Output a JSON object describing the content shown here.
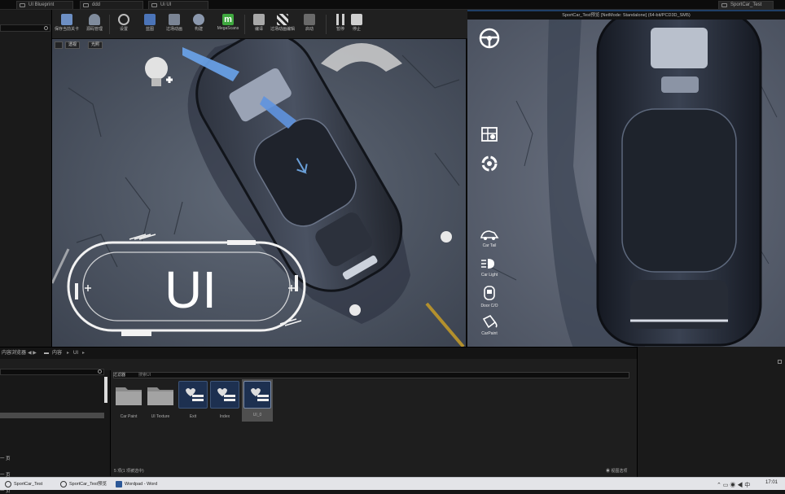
{
  "window": {
    "tabs": [
      {
        "label": "UI Blueprint"
      },
      {
        "label": "ddd"
      },
      {
        "label": "Ui UI"
      },
      {
        "label": "SportCar_Test"
      }
    ]
  },
  "toolbar": {
    "buttons": [
      {
        "label": "保存当前关卡",
        "icon": "save-icon"
      },
      {
        "label": "源码管理",
        "icon": "source-control-icon"
      },
      {
        "label": "设置",
        "icon": "settings-icon"
      },
      {
        "label": "蓝图",
        "icon": "blueprint-icon"
      },
      {
        "label": "过场动画",
        "icon": "cinematics-icon"
      },
      {
        "label": "构建",
        "icon": "build-icon"
      },
      {
        "label": "MegaScans",
        "icon": "megascans-icon"
      },
      {
        "label": "编译",
        "icon": "compile-icon"
      },
      {
        "label": "过场动画编辑",
        "icon": "clapper-icon"
      },
      {
        "label": "启动",
        "icon": "launch-icon"
      },
      {
        "label": "暂停",
        "icon": "pause-icon"
      },
      {
        "label": "停止",
        "icon": "stop-icon"
      }
    ]
  },
  "viewport": {
    "perspective_label": "透视",
    "lit_label": "光照",
    "ui_text": "UI"
  },
  "pie": {
    "title": "SportCar_Test预览 [NetMode: Standalone] (64-bit/PCD3D_SM5)",
    "side_items": [
      {
        "label": "",
        "icon": "steering-wheel-icon"
      },
      {
        "label": "",
        "icon": "map-pin-icon"
      },
      {
        "label": "",
        "icon": "swirl-icon"
      },
      {
        "label": "Car Tail",
        "icon": "car-tail-icon"
      },
      {
        "label": "Car Light",
        "icon": "car-light-icon"
      },
      {
        "label": "Door C/O",
        "icon": "door-icon"
      },
      {
        "label": "CarPaint",
        "icon": "paint-bucket-icon"
      }
    ]
  },
  "content_browser": {
    "header_label": "内容浏览器",
    "breadcrumb": [
      "内容",
      "UI"
    ],
    "filter_label": "过滤器",
    "filter_placeholder": "搜索UI",
    "tree_items": [
      "一 页",
      "一 页",
      "一 页"
    ],
    "assets": [
      {
        "name": "Car Paint",
        "type": "folder"
      },
      {
        "name": "UI Texture",
        "type": "folder"
      },
      {
        "name": "Exit",
        "type": "widget"
      },
      {
        "name": "Index",
        "type": "widget"
      },
      {
        "name": "UI_0",
        "type": "widget"
      }
    ],
    "status_text": "5 项(1 项被选中)",
    "view_options_label": "视图选项"
  },
  "taskbar": {
    "items": [
      {
        "label": "SportCar_Test"
      },
      {
        "label": "SportCar_Test预览"
      },
      {
        "label": "Wordpad - Word"
      }
    ],
    "clock": "17:01"
  },
  "colors": {
    "editor_bg": "#1e1e1e",
    "accent_blue": "#1f3e66",
    "selected_asset": "#4f4f4f",
    "widget_tile": "#1d3050"
  }
}
